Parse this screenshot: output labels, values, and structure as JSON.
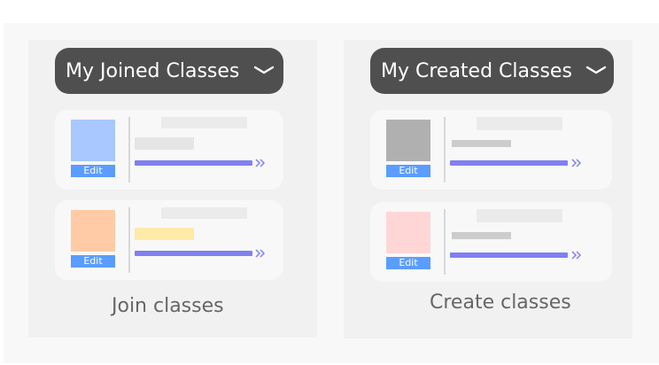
{
  "joined": {
    "title": "My Joined Classes",
    "caption": "Join classes",
    "cards": [
      {
        "edit_label": "Edit",
        "thumb_color": "#a8c8ff"
      },
      {
        "edit_label": "Edit",
        "thumb_color": "#ffcba6",
        "highlight_color": "#ffeaa8"
      }
    ]
  },
  "created": {
    "title": "My Created Classes",
    "caption": "Create classes",
    "cards": [
      {
        "edit_label": "Edit",
        "thumb_color": "#b0b0b0"
      },
      {
        "edit_label": "Edit",
        "thumb_color": "#ffd6d6"
      }
    ]
  },
  "colors": {
    "pill": "#4f4f4f",
    "edit": "#5b9cff",
    "progress": "#8080f0",
    "placeholder": "#ebebeb"
  },
  "icons": {
    "dropdown": "chevron-down-icon",
    "more": "double-chevron-right-icon"
  }
}
